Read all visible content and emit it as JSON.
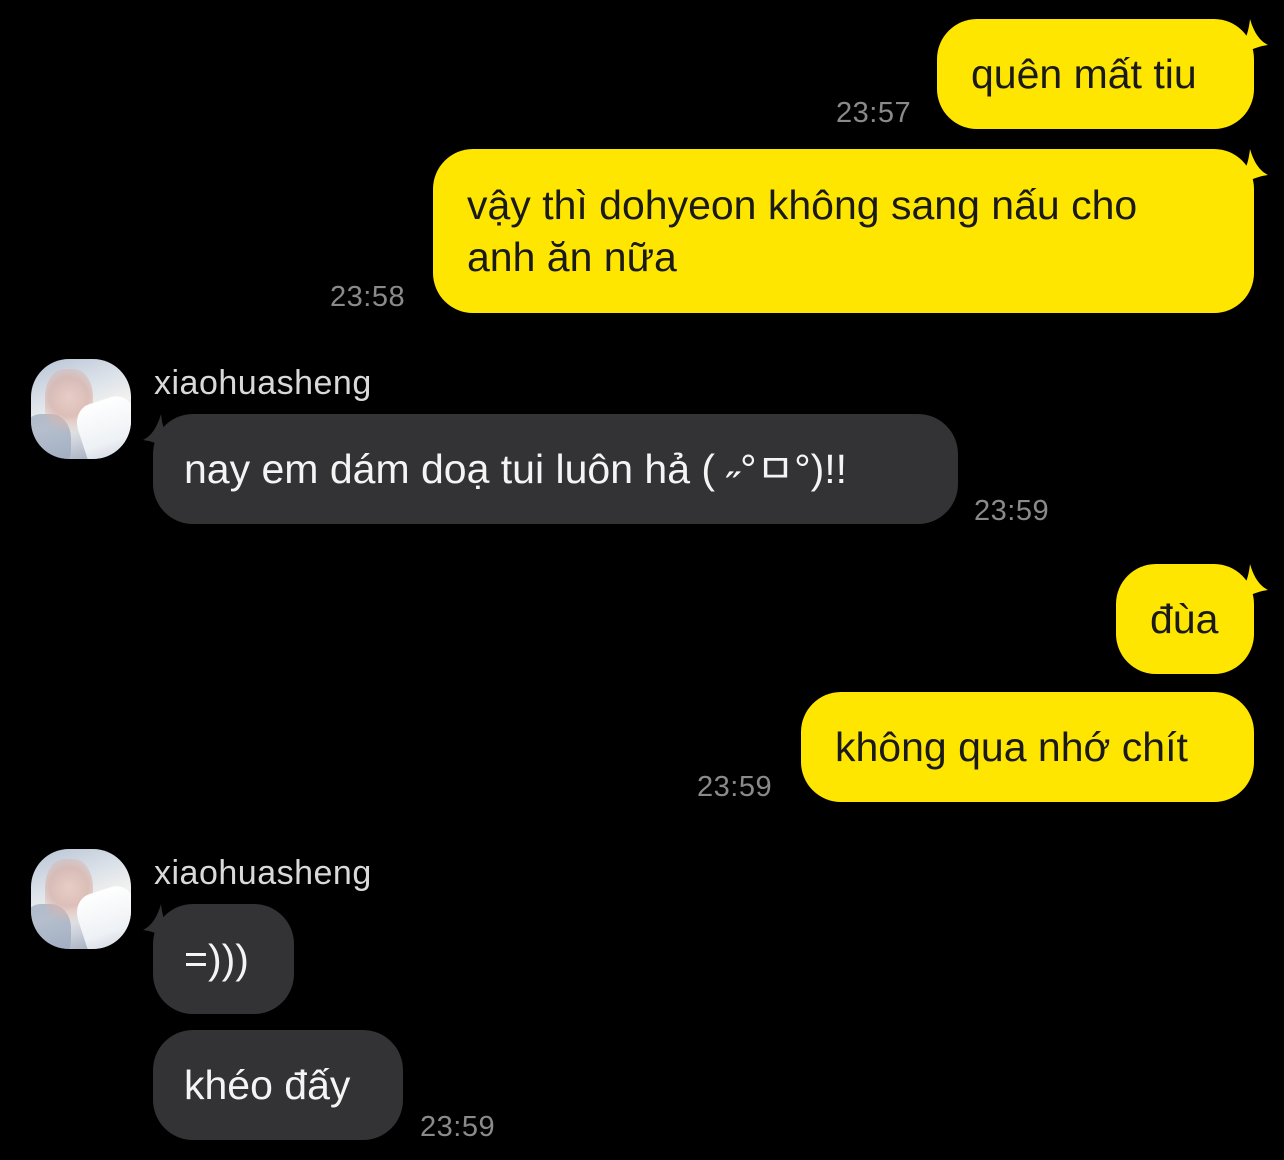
{
  "colors": {
    "background": "#000000",
    "outgoing_bubble": "#ffe600",
    "incoming_bubble": "#333335",
    "timestamp": "#8a8a8a"
  },
  "messages": [
    {
      "direction": "outgoing",
      "text": "quên mất tiu",
      "time": "23:57"
    },
    {
      "direction": "outgoing",
      "text": "vậy thì dohyeon không sang nấu cho\nanh ăn nữa",
      "time": "23:58"
    },
    {
      "direction": "incoming",
      "sender": "xiaohuasheng",
      "avatar_icon": "avatar-photo",
      "text": "nay em dám doạ tui luôn hả ( ˶°ㅁ°)!!",
      "time": "23:59"
    },
    {
      "direction": "outgoing",
      "text": "đùa",
      "time": ""
    },
    {
      "direction": "outgoing",
      "text": "không qua nhớ chít",
      "time": "23:59"
    },
    {
      "direction": "incoming",
      "sender": "xiaohuasheng",
      "avatar_icon": "avatar-photo",
      "text": "=)))",
      "time": ""
    },
    {
      "direction": "incoming",
      "text": "khéo đấy",
      "time": "23:59"
    }
  ]
}
